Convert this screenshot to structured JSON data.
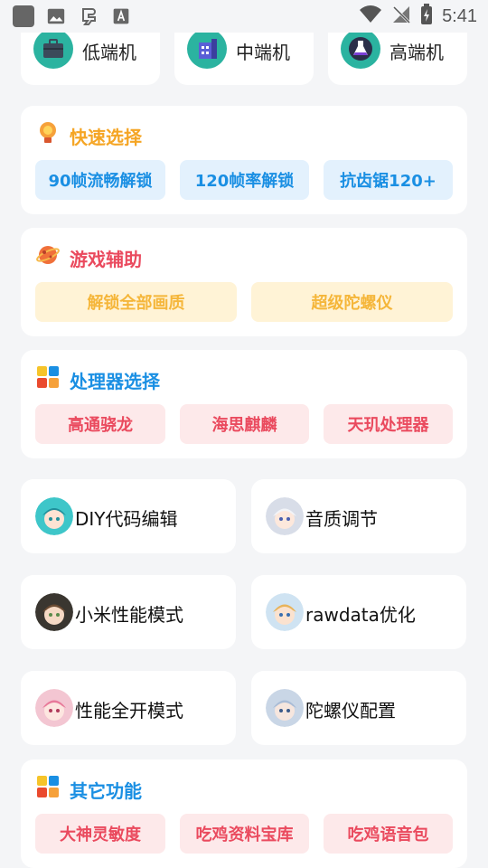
{
  "status_bar": {
    "time": "5:41",
    "left_icons": [
      "app-square-icon",
      "image-icon",
      "bug-icon",
      "text-icon"
    ],
    "right_icons": [
      "wifi-icon",
      "no-signal-icon",
      "battery-charging-icon"
    ]
  },
  "devices": [
    {
      "label": "低端机",
      "icon": "toolbox-icon",
      "color": "#2bb3a0"
    },
    {
      "label": "中端机",
      "icon": "building-icon",
      "color": "#2bb3a0"
    },
    {
      "label": "高端机",
      "icon": "flask-icon",
      "color": "#2bb3a0"
    }
  ],
  "quick_select": {
    "title": "快速选择",
    "title_color": "#f5a524",
    "buttons": [
      "90帧流畅解锁",
      "120帧率解锁",
      "抗齿锯120+"
    ]
  },
  "game_assist": {
    "title": "游戏辅助",
    "title_color": "#ea4a5e",
    "buttons": [
      "解锁全部画质",
      "超级陀螺仪"
    ]
  },
  "processor": {
    "title": "处理器选择",
    "title_color": "#1a8fe3",
    "buttons": [
      "高通骁龙",
      "海思麒麟",
      "天玑处理器"
    ]
  },
  "features": [
    {
      "label": "DIY代码编辑",
      "avatar": "anime-avatar-teal"
    },
    {
      "label": "音质调节",
      "avatar": "anime-avatar-white"
    },
    {
      "label": "小米性能模式",
      "avatar": "anime-avatar-brown"
    },
    {
      "label": "rawdata优化",
      "avatar": "anime-avatar-blonde"
    },
    {
      "label": "性能全开模式",
      "avatar": "anime-avatar-pink"
    },
    {
      "label": "陀螺仪配置",
      "avatar": "anime-avatar-silver"
    }
  ],
  "other": {
    "title": "其它功能",
    "title_color": "#1a8fe3",
    "buttons": [
      "大神灵敏度",
      "吃鸡资料宝库",
      "吃鸡语音包"
    ]
  }
}
